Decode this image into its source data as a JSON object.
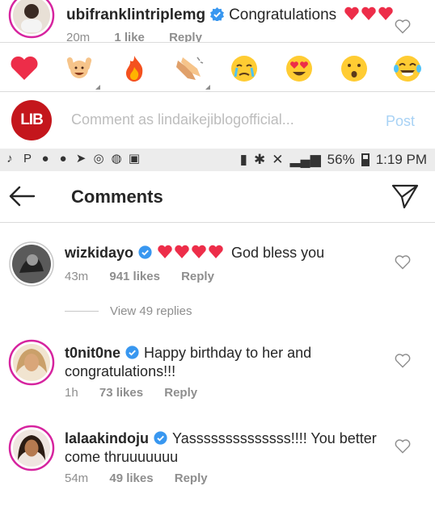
{
  "top_comment": {
    "username": "ubifranklintriplemg",
    "text": "Congratulations",
    "time": "20m",
    "likes": "1 like",
    "reply": "Reply"
  },
  "emoji_bar": {
    "items": [
      "red-heart",
      "raising-hands",
      "fire",
      "clapping-hands",
      "crying-face",
      "heart-eyes-face",
      "astonished-face",
      "tears-of-joy-face"
    ]
  },
  "comment_input": {
    "avatar_label": "LIB",
    "placeholder": "Comment as lindaikejiblogofficial...",
    "post_label": "Post"
  },
  "status_bar": {
    "battery": "56%",
    "time": "1:19 PM"
  },
  "header": {
    "title": "Comments"
  },
  "comments": [
    {
      "username": "wizkidayo",
      "text": "God bless you",
      "time": "43m",
      "likes": "941 likes",
      "reply": "Reply"
    },
    {
      "username": "t0nit0ne",
      "text": "Happy birthday to her and congratulations!!!",
      "time": "1h",
      "likes": "73 likes",
      "reply": "Reply"
    },
    {
      "username": "lalaakindoju",
      "text": "Yassssssssssssss!!!! You better come thruuuuuuu",
      "time": "54m",
      "likes": "49 likes",
      "reply": "Reply"
    }
  ],
  "view_replies": "View 49 replies",
  "colors": {
    "heart_red": "#ed2d49",
    "verified_blue": "#3897f0",
    "link_blue_disabled": "#a8d2f5",
    "lib_red": "#c4161c"
  }
}
